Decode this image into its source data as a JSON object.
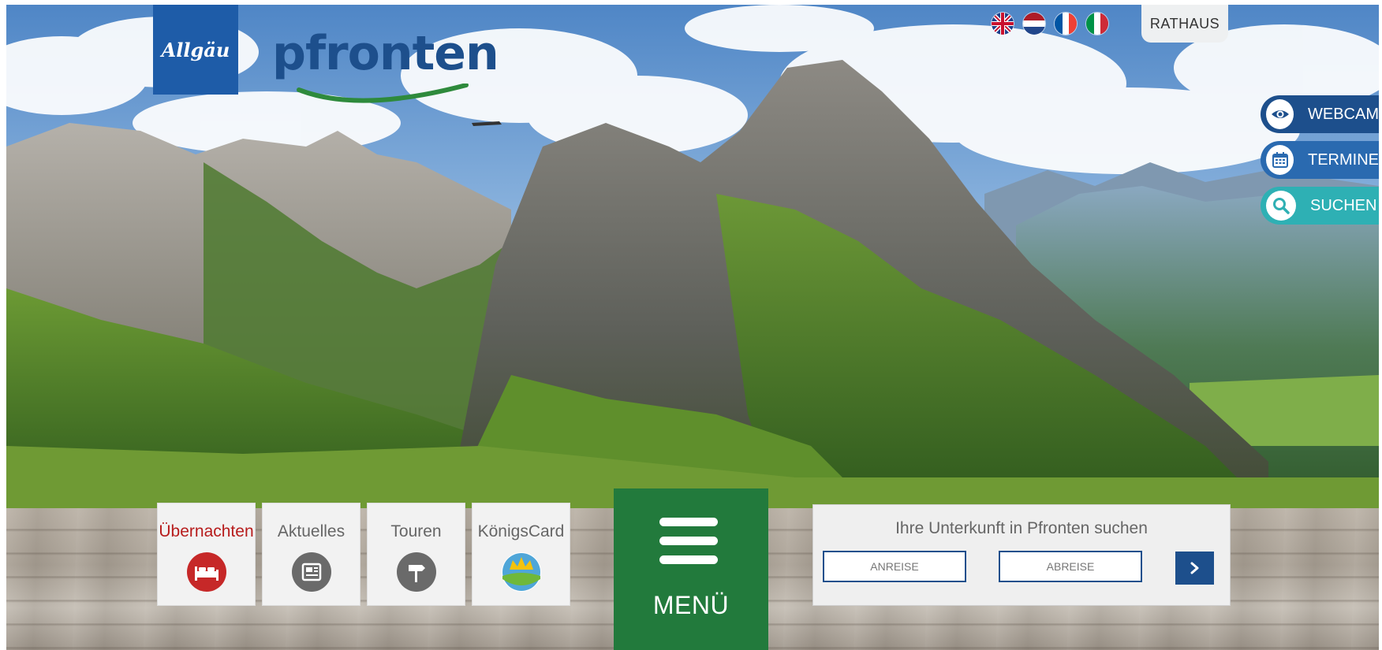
{
  "brand": {
    "region_logo": "Allgäu",
    "town_logo": "pfronten"
  },
  "header": {
    "languages": [
      "english-flag-icon",
      "dutch-flag-icon",
      "french-flag-icon",
      "italian-flag-icon"
    ],
    "rathaus_label": "RATHAUS"
  },
  "side_buttons": [
    {
      "label": "WEBCAM",
      "icon": "eye-icon",
      "color": "#1d4f8c"
    },
    {
      "label": "TERMINE",
      "icon": "calendar-icon",
      "color": "#2a6ab0"
    },
    {
      "label": "SUCHEN",
      "icon": "search-icon",
      "color": "#2eb0b4"
    }
  ],
  "tiles": [
    {
      "label": "Übernachten",
      "icon": "bed-icon",
      "color": "#b71c1c",
      "active": true
    },
    {
      "label": "Aktuelles",
      "icon": "newspaper-icon",
      "color": "#666666",
      "active": false
    },
    {
      "label": "Touren",
      "icon": "signpost-icon",
      "color": "#666666",
      "active": false
    },
    {
      "label": "KönigsCard",
      "icon": "crown-icon",
      "color": "#666666",
      "active": false
    }
  ],
  "menu": {
    "label": "MENÜ",
    "icon": "hamburger-icon",
    "color": "#227a3c"
  },
  "accommodation_search": {
    "title": "Ihre Unterkunft in Pfronten suchen",
    "arrival_placeholder": "ANREISE",
    "departure_placeholder": "ABREISE",
    "submit_icon": "chevron-right-icon"
  }
}
